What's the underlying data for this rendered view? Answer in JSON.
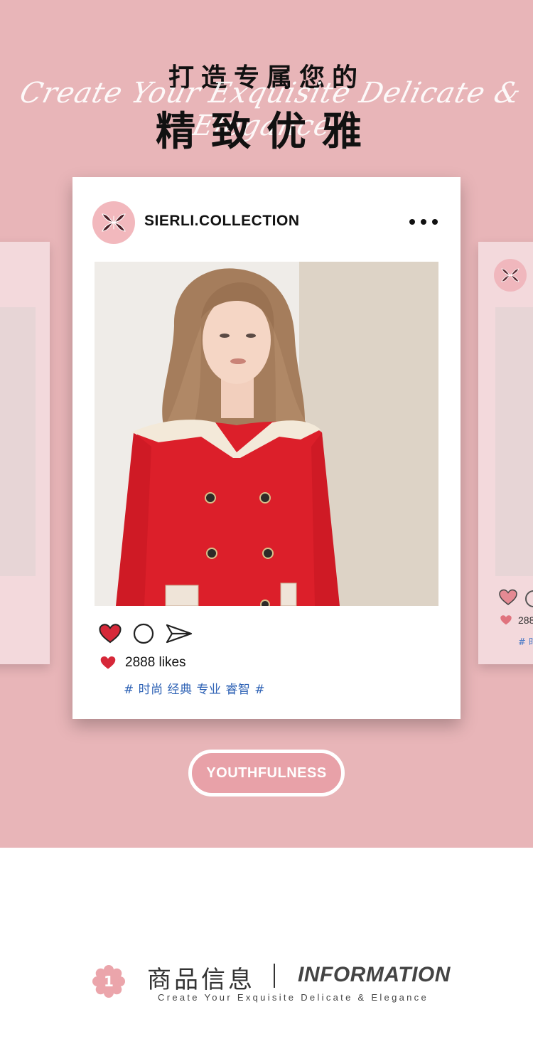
{
  "header": {
    "title_line1": "打造专属您的",
    "script_text": "Create Your Exquisite Delicate & Elegance",
    "title_line2": "精致优雅"
  },
  "post": {
    "account_name": "SIERLI.COLLECTION",
    "likes_text": "2888 likes",
    "tags": "# 时尚 经典 专业 睿智 #"
  },
  "side_card_right": {
    "likes_text": "288",
    "tags": "# 时"
  },
  "youth_button": {
    "label": "YOUTHFULNESS"
  },
  "info": {
    "number": "1",
    "title_cn": "商品信息",
    "title_en": "INFORMATION",
    "subtitle": "Create Your Exquisite Delicate & Elegance"
  },
  "colors": {
    "hero_bg": "#e8b5b8",
    "card_bg": "#ffffff",
    "heart_red": "#d62839",
    "tag_blue": "#2e62b5",
    "logo_pink": "#f2b8bd"
  },
  "icons": [
    "more-icon",
    "heart-icon",
    "comment-icon",
    "send-icon",
    "brand-logo-icon",
    "flower-icon"
  ]
}
